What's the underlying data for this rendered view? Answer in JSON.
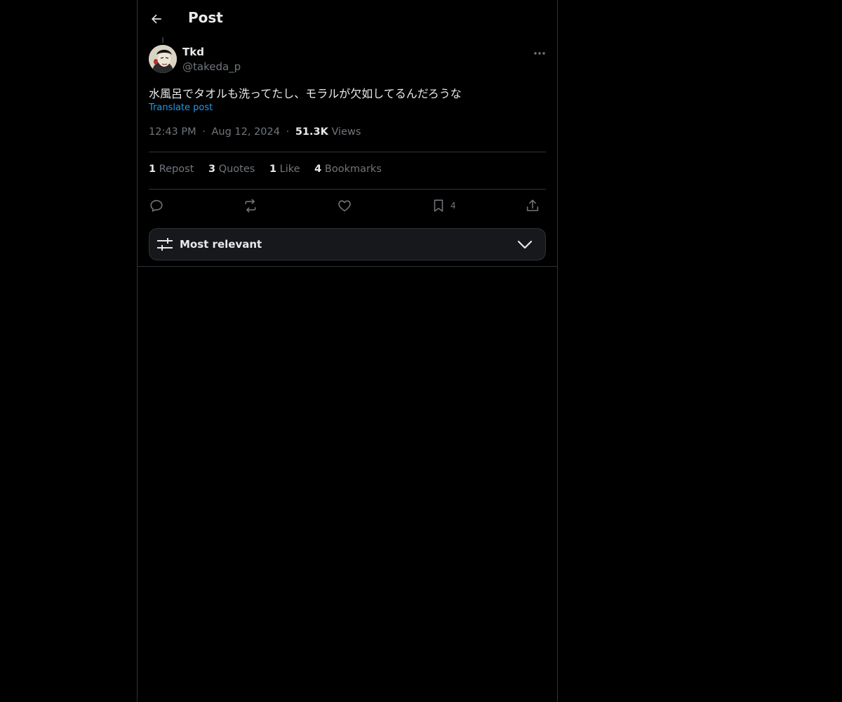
{
  "header": {
    "title": "Post",
    "back_icon": "arrow-left-icon"
  },
  "post": {
    "author_name": "Tkd",
    "author_handle": "@takeda_p",
    "text": "水風呂でタオルも洗ってたし、モラルが欠如してるんだろうな",
    "translate_label": "Translate post",
    "time": "12:43 PM",
    "separator": "·",
    "date": "Aug 12, 2024",
    "views_count": "51.3K",
    "views_label": "Views"
  },
  "stats": [
    {
      "num": "1",
      "label": "Repost"
    },
    {
      "num": "3",
      "label": "Quotes"
    },
    {
      "num": "1",
      "label": "Like"
    },
    {
      "num": "4",
      "label": "Bookmarks"
    }
  ],
  "actions": {
    "reply_icon": "reply-icon",
    "repost_icon": "repost-icon",
    "like_icon": "heart-icon",
    "bookmark_icon": "bookmark-icon",
    "bookmark_count": "4",
    "share_icon": "share-icon"
  },
  "sort": {
    "label": "Most relevant",
    "icon": "sliders-icon"
  },
  "colors": {
    "background": "#000000",
    "text": "#e7e9ea",
    "muted": "#71767b",
    "accent": "#1d9bf0",
    "border": "#2f3336"
  }
}
